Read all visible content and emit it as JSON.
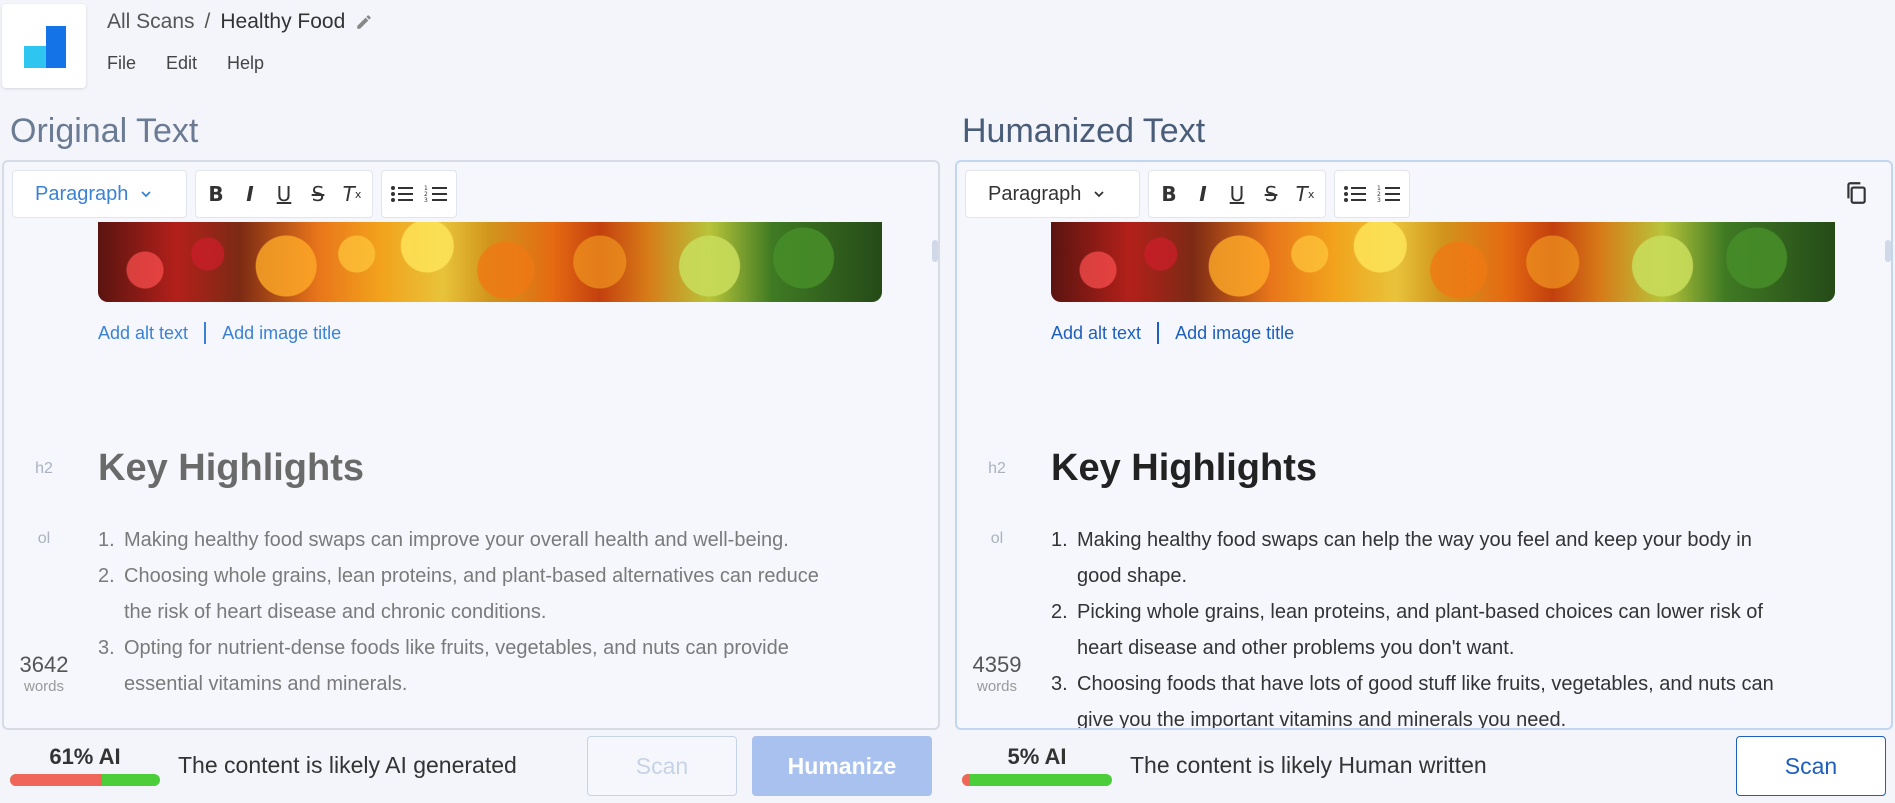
{
  "breadcrumb": {
    "root": "All Scans",
    "separator": "/",
    "current": "Healthy Food"
  },
  "menu": [
    "File",
    "Edit",
    "Help"
  ],
  "left": {
    "title": "Original Text",
    "paragraph_label": "Paragraph",
    "alt_text": "Add alt text",
    "image_title": "Add image title",
    "h2_tag": "h2",
    "ol_tag": "ol",
    "heading": "Key Highlights",
    "items": [
      {
        "num": "1.",
        "text": "Making healthy food swaps can improve your overall health and well-being."
      },
      {
        "num": "2.",
        "text": "Choosing whole grains, lean proteins, and plant-based alternatives can reduce the risk of heart disease and chronic conditions."
      },
      {
        "num": "3.",
        "text": "Opting for nutrient-dense foods like fruits, vegetables, and nuts can provide essential vitamins and minerals."
      }
    ],
    "word_count": "3642",
    "words_label": "words",
    "ai_percent": "61% AI",
    "ai_fraction": 0.61,
    "status_text": "The content is likely AI generated",
    "scan_label": "Scan",
    "humanize_label": "Humanize"
  },
  "right": {
    "title": "Humanized Text",
    "paragraph_label": "Paragraph",
    "alt_text": "Add alt text",
    "image_title": "Add image title",
    "h2_tag": "h2",
    "ol_tag": "ol",
    "heading": "Key Highlights",
    "items": [
      {
        "num": "1.",
        "text": "Making healthy food swaps can help the way you feel and keep your body in good shape."
      },
      {
        "num": "2.",
        "text": "Picking whole grains, lean proteins, and plant-based choices can lower risk of heart disease and other problems you don't want."
      },
      {
        "num": "3.",
        "text": "Choosing foods that have lots of good stuff like fruits, vegetables, and nuts can give you the important vitamins and minerals you need."
      }
    ],
    "word_count": "4359",
    "words_label": "words",
    "ai_percent": "5% AI",
    "ai_fraction": 0.05,
    "status_text": "The content is likely Human written",
    "scan_label": "Scan"
  },
  "colors": {
    "accent": "#1d5fbf",
    "ai_red": "#f0665a",
    "human_green": "#4ccd3a"
  }
}
